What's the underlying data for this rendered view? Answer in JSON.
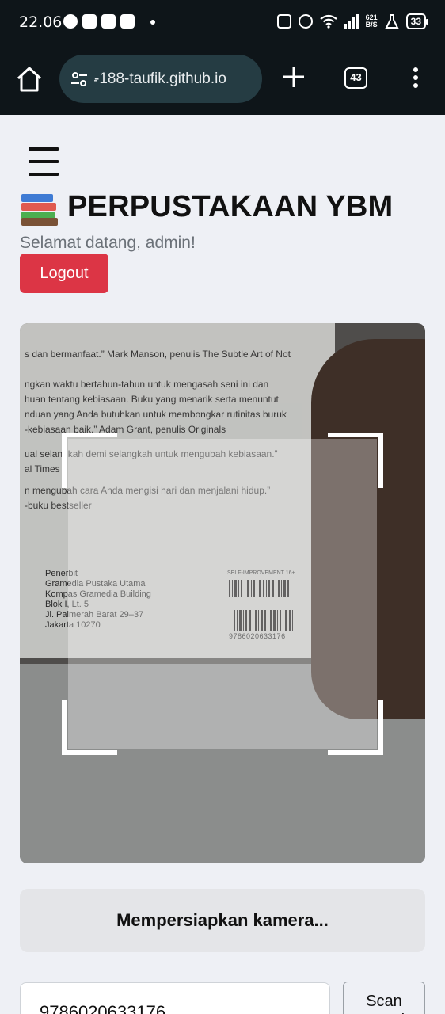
{
  "status_bar": {
    "time": "22.06",
    "network_speed": "621",
    "network_unit": "B/S",
    "battery": "33"
  },
  "browser": {
    "url": "̵-188-taufik.github.io",
    "tab_count": "43"
  },
  "header": {
    "title": "PERPUSTAKAAN YBM",
    "welcome": "Selamat datang, admin!",
    "logout_label": "Logout"
  },
  "scanner": {
    "status": "Mempersiapkan kamera..."
  },
  "isbn_form": {
    "value": "9786020633176",
    "scan_button_label": "Scan Barcode"
  },
  "camera_feed": {
    "line1": "s dan bermanfaat.” Mark Manson, penulis The Subtle Art of Not",
    "line2": "ngkan waktu bertahun-tahun untuk mengasah seni ini dan",
    "line3": "huan tentang kebiasaan. Buku yang menarik serta menuntut",
    "line4": "nduan yang Anda butuhkan untuk membongkar rutinitas buruk",
    "line5": "-kebiasaan baik.” Adam Grant, penulis Originals",
    "line6": "ual selangkah demi selangkah untuk mengubah kebiasaan.”",
    "line7": "al Times",
    "line8": "n mengubah cara Anda mengisi hari dan menjalani hidup.”",
    "line9": "-buku bestseller",
    "publisher": [
      "Penerbit",
      "Gramedia Pustaka Utama",
      "Kompas Gramedia Building",
      "Blok I, Lt. 5",
      "Jl. Palmerah Barat 29–37",
      "Jakarta 10270"
    ],
    "category": "SELF-IMPROVEMENT 16+",
    "barcode_number": "9786020633176"
  }
}
